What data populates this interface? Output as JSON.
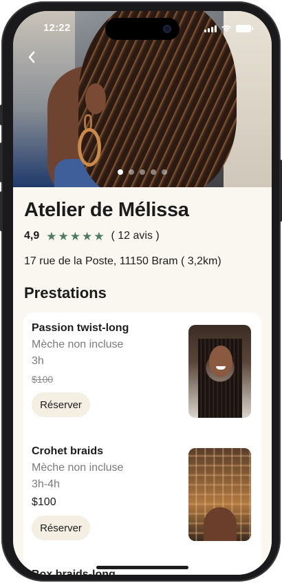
{
  "status_bar": {
    "time": "12:22"
  },
  "hero": {
    "slide_count": 5,
    "active_slide": 1
  },
  "salon": {
    "name": "Atelier de Mélissa",
    "rating": "4,9",
    "stars": 5,
    "reviews": "( 12 avis )",
    "address": "17 rue de la Poste, 11150 Bram ( 3,2km)"
  },
  "section_title": "Prestations",
  "services": [
    {
      "name": "Passion twist-long",
      "note": "Mèche non incluse",
      "duration": "3h",
      "price": "$100",
      "price_struck": true,
      "button": "Réserver"
    },
    {
      "name": "Crohet braids",
      "note": "Mèche non incluse",
      "duration": "3h-4h",
      "price": "$100",
      "price_struck": false,
      "button": "Réserver"
    }
  ],
  "next_service_peek": "Box braids-long",
  "colors": {
    "accent": "#4d7a63",
    "background": "#faf7f1",
    "button": "#f4eee3"
  }
}
